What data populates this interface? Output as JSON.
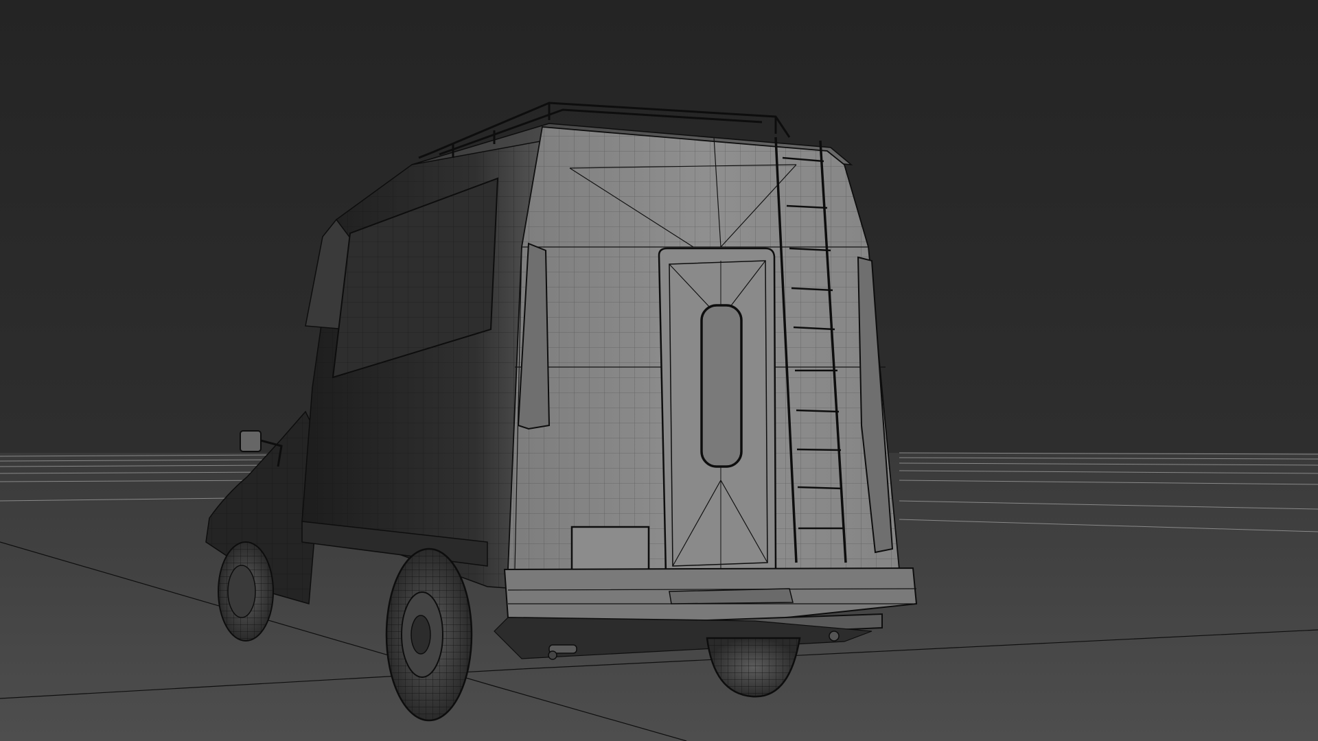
{
  "viewport": {
    "shading_mode": "shaded-with-wireframe-edges",
    "background_color": "#262626",
    "ground_color": "#4a4a4a",
    "model_color": "#8c8c8c",
    "wire_color": "#141414",
    "grid_line_color": "#9a9a9a"
  },
  "scene": {
    "object": "camper-van-rear-three-quarter-view",
    "wheels_visible": 3,
    "features": [
      "roof-rack",
      "rear-ladder",
      "rear-door-window",
      "side-mirror",
      "rear-bumper",
      "tail-lights",
      "license-plate"
    ]
  }
}
